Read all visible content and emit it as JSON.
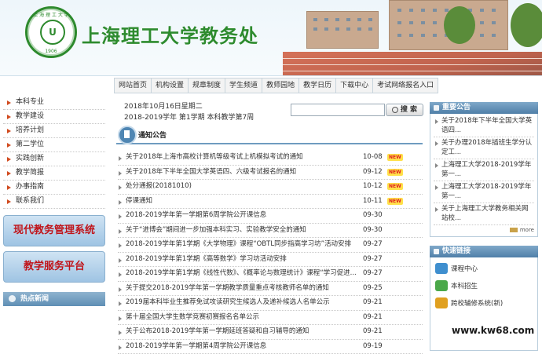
{
  "site": {
    "title": "上海理工大学教务处",
    "logo_ring_top": "上 海 理 工 大 学",
    "logo_ring_bottom": "1906",
    "logo_center": "U"
  },
  "nav": {
    "items": [
      "网站首页",
      "机构设置",
      "规章制度",
      "学生频道",
      "教师园地",
      "教学日历",
      "下载中心",
      "考试网络报名入口"
    ]
  },
  "sidebar": {
    "items": [
      "本科专业",
      "教学建设",
      "培养计划",
      "第二学位",
      "实践创新",
      "教学简报",
      "办事指南",
      "联系我们"
    ],
    "buttons": [
      "现代教务管理系统",
      "教学服务平台"
    ],
    "hot_news_label": "热点新闻"
  },
  "header_info": {
    "date_line": "2018年10月16日星期二",
    "term_line": "2018-2019学年 第1学期 本科教学第7周"
  },
  "search": {
    "placeholder": "",
    "button_label": "搜 索"
  },
  "notices": {
    "title": "通知公告",
    "rows": [
      {
        "text": "关于2018年上海市高校计算机等级考试上机模拟考试的通知",
        "date": "10-08",
        "new": "NEW"
      },
      {
        "text": "关于2018年下半年全国大学英语四、六级考试报名的通知",
        "date": "09-12",
        "new": "NEW"
      },
      {
        "text": "处分通报(20181010)",
        "date": "10-12",
        "new": "NEW"
      },
      {
        "text": "停课通知",
        "date": "10-11",
        "new": "NEW"
      },
      {
        "text": "2018-2019学年第一学期第6周学院公开课信息",
        "date": "09-30",
        "new": ""
      },
      {
        "text": "关于“进博会”期间进一步加强本科实习、实验教学安全的通知",
        "date": "09-30",
        "new": ""
      },
      {
        "text": "2018-2019学年第1学期《大学物理》课程“OBTL同步指高学习坊”活动安排",
        "date": "09-27",
        "new": ""
      },
      {
        "text": "2018-2019学年第1学期《高等数学》学习坊活动安排",
        "date": "09-27",
        "new": ""
      },
      {
        "text": "2018-2019学年第1学期《线性代数》、《概率论与数理统计》课程“学习促进...",
        "date": "09-27",
        "new": ""
      },
      {
        "text": "关于提交2018-2019学年第一学期教学质量重点考核教师名单的通知",
        "date": "09-25",
        "new": ""
      },
      {
        "text": "2019届本科毕业生推荐免试攻读研究生候选人及递补候选人名单公示",
        "date": "09-21",
        "new": ""
      },
      {
        "text": "第十届全国大学生数学竞赛初赛报名名单公示",
        "date": "09-21",
        "new": ""
      },
      {
        "text": "关于公布2018-2019学年第一学期延班答疑和自习辅导的通知",
        "date": "09-21",
        "new": ""
      },
      {
        "text": "2018-2019学年第一学期第4周学院公开课信息",
        "date": "09-19",
        "new": ""
      }
    ]
  },
  "announcements": {
    "title": "重要公告",
    "items": [
      "关于2018年下半年全国大学英语四...",
      "关于办理2018年插班生学分认定工...",
      "上海理工大学2018-2019学年第一...",
      "上海理工大学2018-2019学年第一...",
      "关于上海理工大学教务相关网站校..."
    ],
    "more_label": "more"
  },
  "quick_links": {
    "title": "快速链接",
    "items": [
      {
        "label": "课程中心",
        "color": "#3f8fcf"
      },
      {
        "label": "本科招生",
        "color": "#4aa84a"
      },
      {
        "label": "跨校辅修系统(新)",
        "color": "#e0a020"
      }
    ]
  },
  "watermark": "www.kw68.com"
}
